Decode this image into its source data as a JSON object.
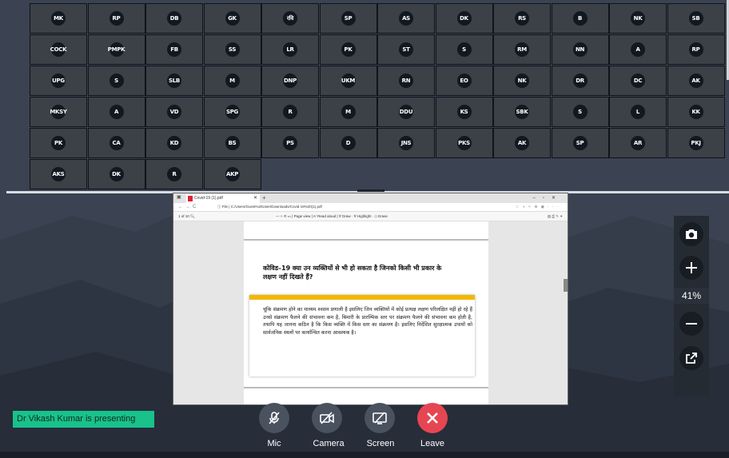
{
  "participants": [
    [
      "MK",
      "RP",
      "DB",
      "GK",
      "रवि",
      "SP",
      "AS",
      "DK",
      "RS",
      "B",
      "NK",
      "SB"
    ],
    [
      "COCK",
      "PMPK",
      "FB",
      "SS",
      "LR",
      "PK",
      "ST",
      "S",
      "RM",
      "NN",
      "A",
      "RP"
    ],
    [
      "UPG",
      "S",
      "SLB",
      "M",
      "DNP",
      "UKM",
      "RN",
      "EO",
      "NK",
      "DR",
      "DC",
      "AK"
    ],
    [
      "MKSY",
      "A",
      "VD",
      "SPG",
      "R",
      "M",
      "DDU",
      "KS",
      "SBK",
      "S",
      "L",
      "KK"
    ],
    [
      "PK",
      "CA",
      "KD",
      "BS",
      "PS",
      "D",
      "JNS",
      "PKS",
      "AK",
      "SP",
      "AR",
      "PKJ"
    ],
    [
      "AKS",
      "DK",
      "R",
      "AKP"
    ]
  ],
  "shared_screen": {
    "tab_title": "Covid-19 (1).pdf",
    "url": "C:/Users/Guest%20User/Downloads/Covid-19%20(1).pdf",
    "url_prefix": "File",
    "page_indicator": "of 10",
    "toolbar_items": "—   +   ⟲   ▭  |  Page view  |  A⁾ Read aloud  |  ∀ Draw ·  ∀ Highlight ·  ◇ Erase",
    "heading": "कोविड–19 क्या उन व्यक्तियों से भी हो सकता है जिनको किसी भी प्रकार के लक्षण नहीं दिखते हैं?",
    "body": "चूंकि संक्रमण होने का माध्यम श्वसन प्रणाली है इसलिए जिन व्यक्तियों में कोई प्रत्यक्ष लक्षण परिलक्षित नहीं हो रहे हैं उनसे संक्रमण फैलने की संभावना कम है, बिमारी के प्रारम्भिक स्तर पर संक्रमण फैलने की संभावना कम होती है, तथापि यह जानना कठिन है कि किस व्यक्ति में किस स्तर का संक्रमण है। इसलिए निर्देशित सुरक्षात्मक उपायों को सार्वजनिक स्थलों पर कार्यान्वित करना आवश्यक है।"
  },
  "zoom": {
    "level": "41%"
  },
  "presenter_banner": "Dr Vikash Kumar is presenting",
  "controls": {
    "mic": "Mic",
    "camera": "Camera",
    "screen": "Screen",
    "leave": "Leave"
  },
  "colors": {
    "accent_green": "#19c28a",
    "leave_red": "#e64652",
    "pdf_yellow": "#f2b705"
  }
}
